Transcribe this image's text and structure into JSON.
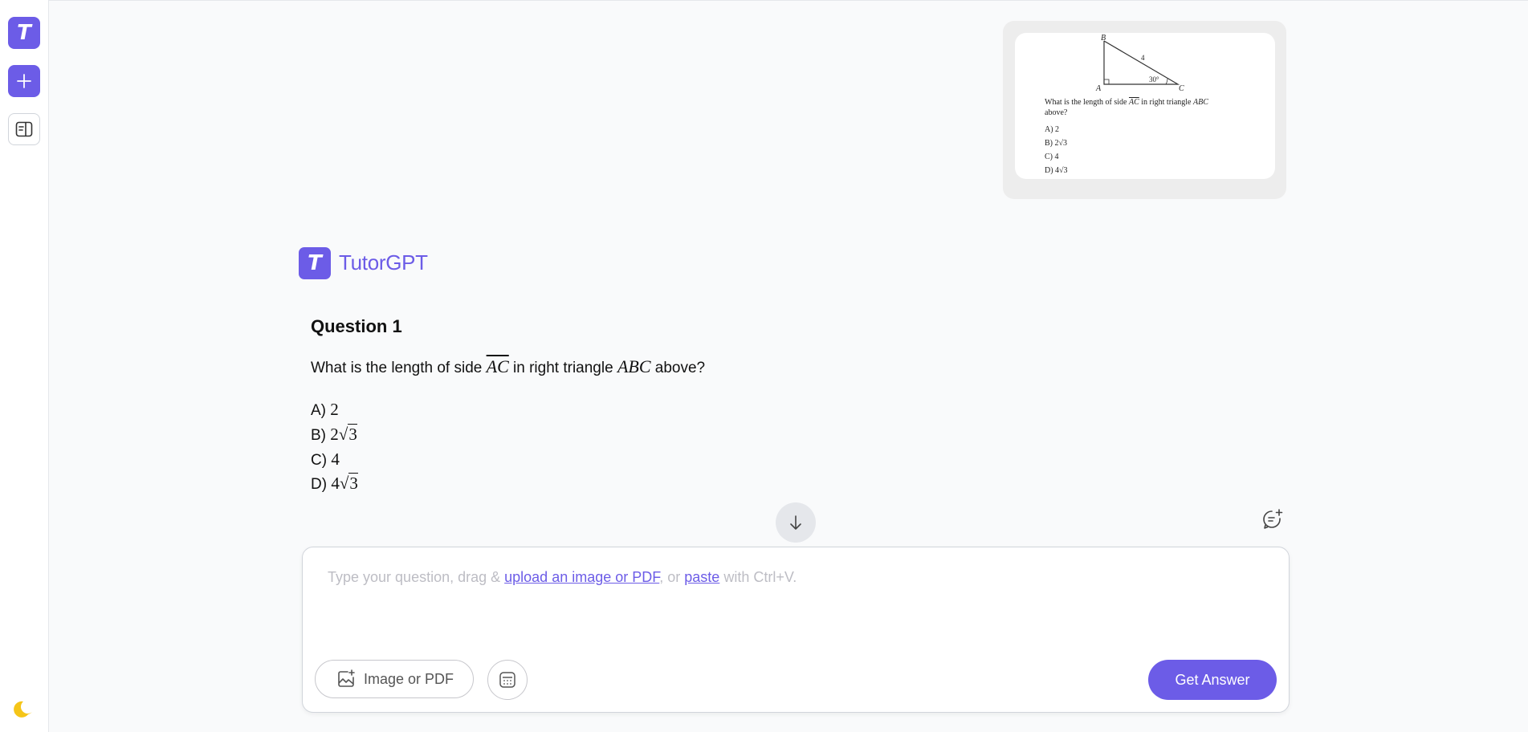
{
  "app": {
    "logo_letter": "T",
    "brand_name": "TutorGPT",
    "accent_color": "#6c5ce7"
  },
  "sidebar": {
    "icons": [
      "new-chat-plus-icon",
      "panel-toggle-icon",
      "moon-icon"
    ]
  },
  "uploaded_image": {
    "vertex_b": "B",
    "vertex_a": "A",
    "vertex_c": "C",
    "side_label": "4",
    "angle_label": "30°",
    "question_line1_pre": "What is the length of side ",
    "question_line1_side": "AC",
    "question_line1_mid": " in right triangle ",
    "question_line1_tri": "ABC",
    "question_line2": "above?",
    "choices": [
      "A)  2",
      "B)  2√3",
      "C)  4",
      "D)  4√3"
    ]
  },
  "question": {
    "title": "Question 1",
    "text_pre": "What is the length of side ",
    "side": "AC",
    "text_mid": " in right triangle ",
    "triangle": "ABC",
    "text_post": " above?",
    "choices": [
      {
        "label": "A) ",
        "value": "2",
        "radicand": ""
      },
      {
        "label": "B) ",
        "value": "2",
        "radicand": "3"
      },
      {
        "label": "C) ",
        "value": "4",
        "radicand": ""
      },
      {
        "label": "D) ",
        "value": "4",
        "radicand": "3"
      }
    ]
  },
  "composer": {
    "placeholder_pre": "Type your question, drag & ",
    "placeholder_link1": "upload an image or PDF",
    "placeholder_mid": ", or ",
    "placeholder_link2": "paste",
    "placeholder_post": " with Ctrl+V.",
    "upload_button_label": "Image or PDF",
    "submit_button_label": "Get Answer"
  }
}
